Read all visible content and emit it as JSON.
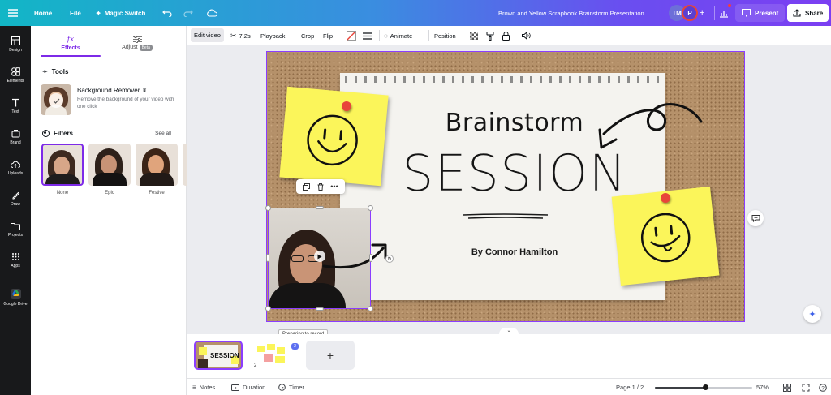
{
  "topbar": {
    "home": "Home",
    "file": "File",
    "magic_switch": "Magic Switch",
    "doc_title": "Brown and Yellow Scrapbook Brainstorm Presentation",
    "avatar1": "TM",
    "avatar2": "P",
    "present": "Present",
    "share": "Share"
  },
  "rail": {
    "items": [
      "Design",
      "Elements",
      "Text",
      "Brand",
      "Uploads",
      "Draw",
      "Projects",
      "Apps",
      "Google Drive"
    ]
  },
  "panel": {
    "tab_effects": "Effects",
    "tab_adjust": "Adjust",
    "beta": "Beta",
    "tools_title": "Tools",
    "bg_remover_title": "Background Remover",
    "bg_remover_desc": "Remove the background of your video with one click",
    "filters_title": "Filters",
    "see_all": "See all",
    "filters": [
      "None",
      "Epic",
      "Festive"
    ]
  },
  "ctxbar": {
    "edit_video": "Edit video",
    "duration": "7.2s",
    "playback": "Playback",
    "crop": "Crop",
    "flip": "Flip",
    "animate": "Animate",
    "position": "Position"
  },
  "slide": {
    "heading": "Brainstorm",
    "title": "SESSION",
    "byline": "By Connor Hamilton"
  },
  "tooltip": "Preparing to record",
  "pages": {
    "page2_badge": "2",
    "page2_duration": "2"
  },
  "footer": {
    "notes": "Notes",
    "duration": "Duration",
    "timer": "Timer",
    "page": "Page 1 / 2",
    "zoom": "57%",
    "zoom_fraction": 0.57
  },
  "colors": {
    "accent": "#7d2ae8",
    "selection": "#8b3dff",
    "sticky": "#fbf55a",
    "pin": "#e8443a",
    "cork": "#b5916a"
  }
}
